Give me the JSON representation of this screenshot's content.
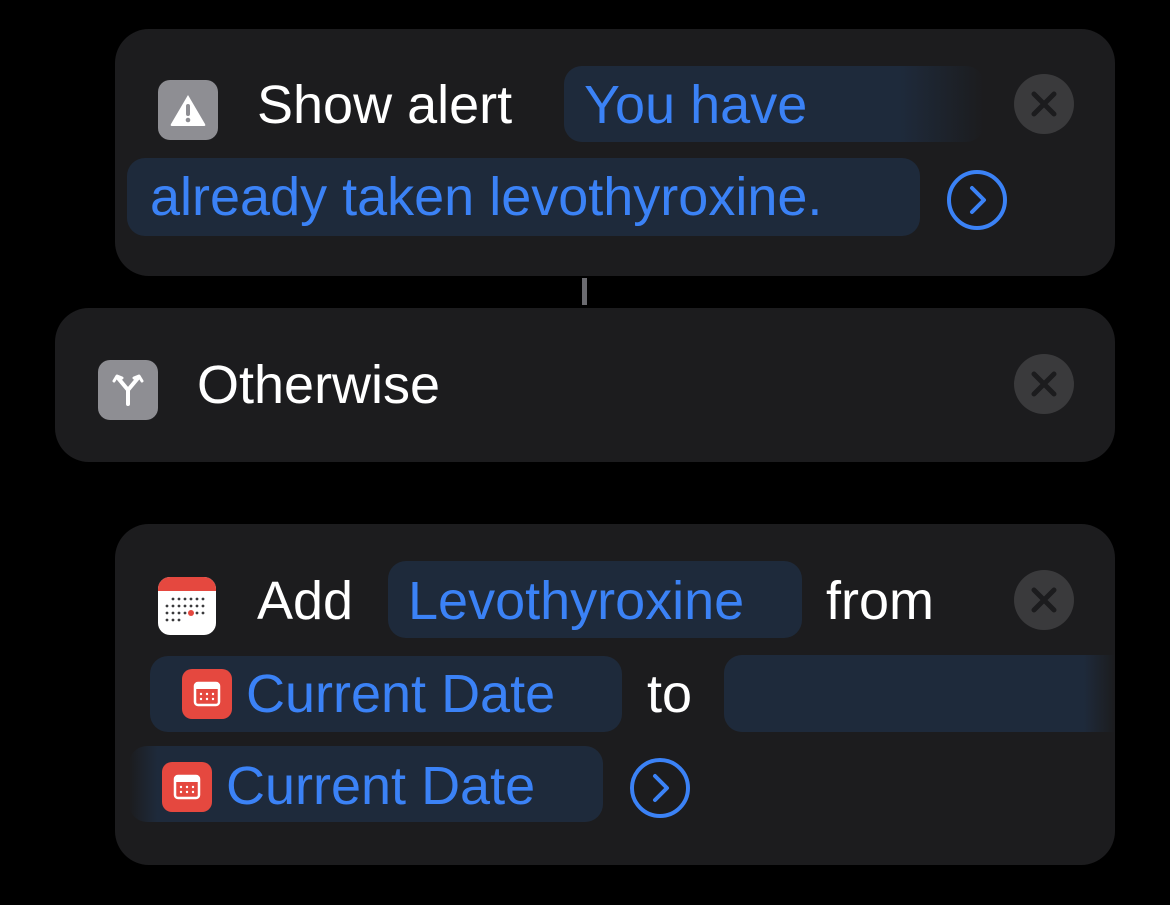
{
  "alert_action": {
    "icon": "warning-icon",
    "label": "Show alert",
    "message_line1": "You have",
    "message_line2": "already taken levothyroxine."
  },
  "otherwise_action": {
    "icon": "branch-icon",
    "label": "Otherwise"
  },
  "add_action": {
    "icon": "calendar-icon",
    "label_add": "Add",
    "event_name": "Levothyroxine",
    "label_from": "from",
    "start_date": "Current Date",
    "label_to": "to",
    "end_date": "Current Date"
  },
  "colors": {
    "background": "#000000",
    "card": "#1c1c1e",
    "accent_blue": "#3b82f6",
    "pill_bg": "#1e2a3b",
    "calendar_red": "#e5483f"
  }
}
